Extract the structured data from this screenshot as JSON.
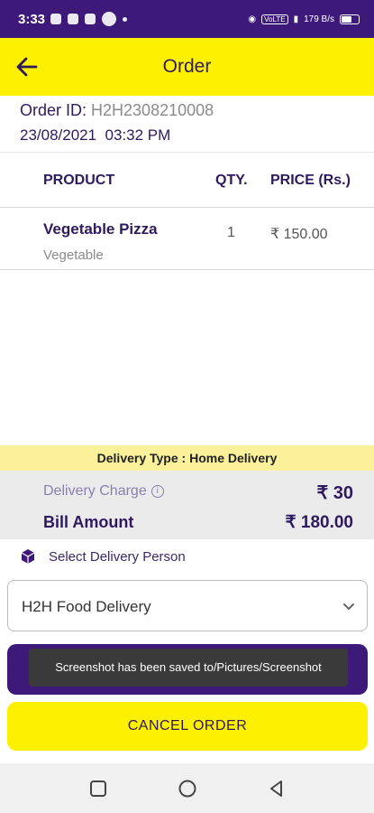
{
  "status_bar": {
    "time": "3:33",
    "volte": "VoLTE",
    "speed": "179 B/s"
  },
  "header": {
    "title": "Order",
    "icon": "arrow-left-icon"
  },
  "order": {
    "id_label": "Order ID:",
    "id_value": "H2H2308210008",
    "datetime": "23/08/2021  03:32 PM"
  },
  "table": {
    "headers": {
      "product": "PRODUCT",
      "qty": "QTY.",
      "price": "PRICE (Rs.)"
    },
    "rows": [
      {
        "name": "Vegetable Pizza",
        "category": "Vegetable",
        "qty": "1",
        "price": "₹ 150.00"
      }
    ]
  },
  "delivery": {
    "type_text": "Delivery Type : Home Delivery",
    "charge_label": "Delivery Charge",
    "charge_value": "₹ 30",
    "bill_label": "Bill Amount",
    "bill_value": "₹ 180.00"
  },
  "delivery_person": {
    "label": "Select Delivery Person",
    "selected": "H2H Food Delivery"
  },
  "toast": {
    "message": "Screenshot has been saved to/Pictures/Screenshot"
  },
  "actions": {
    "cancel_label": "CANCEL ORDER"
  },
  "colors": {
    "primary": "#3d1a7a",
    "accent": "#fdf000",
    "text": "#2e1a5f"
  }
}
